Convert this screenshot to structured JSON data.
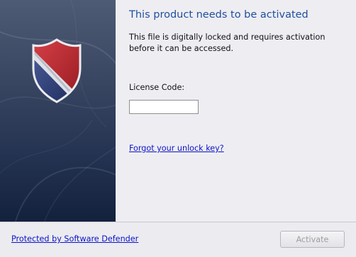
{
  "dialog": {
    "title": "This product needs to be activated",
    "description": "This file is digitally locked and requires activation before it can be accessed.",
    "license_label": "License Code:",
    "license_value": "",
    "forgot_link": "Forgot your unlock key?",
    "protected_link": "Protected by Software Defender",
    "activate_label": "Activate",
    "activate_enabled": false
  },
  "colors": {
    "title": "#1f4f9d",
    "link": "#0b14c4",
    "side_panel_top": "#4e5b74",
    "side_panel_bottom": "#13213d",
    "shield_red": "#b8252b",
    "shield_blue": "#2c3f7c"
  },
  "icons": {
    "shield": "shield-icon"
  }
}
